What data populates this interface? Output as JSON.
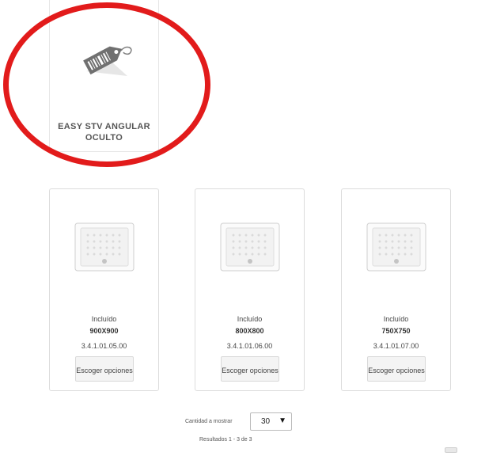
{
  "top_product": {
    "title": "EASY STV ANGULAR OCULTO",
    "icon": "price-tag-icon",
    "annotation_color": "#e21b1b"
  },
  "products": [
    {
      "label": "Incluído",
      "size": "900X900",
      "code": "3.4.1.01.05.00",
      "button": "Escoger opciones",
      "image": "shower-tray-icon"
    },
    {
      "label": "Incluído",
      "size": "800X800",
      "code": "3.4.1.01.06.00",
      "button": "Escoger opciones",
      "image": "shower-tray-icon"
    },
    {
      "label": "Incluído",
      "size": "750X750",
      "code": "3.4.1.01.07.00",
      "button": "Escoger opciones",
      "image": "shower-tray-icon"
    }
  ],
  "pagination": {
    "quantity_label": "Cantidad a mostrar",
    "quantity_value": "30",
    "results_text": "Resultados 1 - 3 de 3"
  }
}
